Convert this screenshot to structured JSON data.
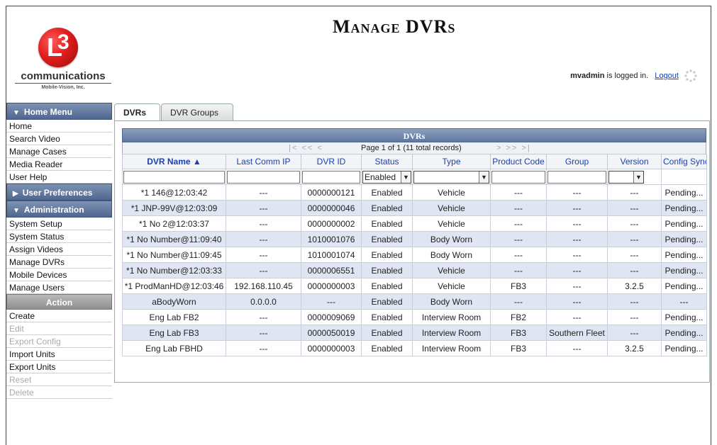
{
  "header": {
    "title": "Manage DVRs",
    "logo_mark": "3",
    "logo_company": "communications",
    "logo_sub": "Mobile-Vision, Inc.",
    "user": "mvadmin",
    "logged_in_text": "is logged in.",
    "logout": "Logout"
  },
  "sidebar": {
    "home_menu": {
      "title": "Home Menu",
      "items": [
        "Home",
        "Search Video",
        "Manage Cases",
        "Media Reader",
        "User Help"
      ]
    },
    "user_prefs": {
      "title": "User Preferences"
    },
    "administration": {
      "title": "Administration",
      "items": [
        "System Setup",
        "System Status",
        "Assign Videos",
        "Manage DVRs",
        "Mobile Devices",
        "Manage Users"
      ]
    },
    "action": {
      "title": "Action",
      "items": [
        {
          "label": "Create",
          "enabled": true
        },
        {
          "label": "Edit",
          "enabled": false
        },
        {
          "label": "Export Config",
          "enabled": false
        },
        {
          "label": "Import Units",
          "enabled": true
        },
        {
          "label": "Export Units",
          "enabled": true
        },
        {
          "label": "Reset",
          "enabled": false
        },
        {
          "label": "Delete",
          "enabled": false
        }
      ]
    }
  },
  "tabs": [
    "DVRs",
    "DVR Groups"
  ],
  "grid": {
    "title": "DVRs",
    "pager_first": "|<",
    "pager_prev_page": "<<",
    "pager_prev": "<",
    "pager_info": "Page 1 of 1 (11 total records)",
    "pager_next": ">",
    "pager_next_page": ">>",
    "pager_last": ">|",
    "columns": [
      "DVR Name ▲",
      "Last Comm IP",
      "DVR ID",
      "Status",
      "Type",
      "Product Code",
      "Group",
      "Version",
      "Config Synch"
    ],
    "status_filter": "Enabled",
    "rows": [
      [
        "*1 146@12:03:42",
        "---",
        "0000000121",
        "Enabled",
        "Vehicle",
        "---",
        "---",
        "---",
        "Pending..."
      ],
      [
        "*1 JNP-99V@12:03:09",
        "---",
        "0000000046",
        "Enabled",
        "Vehicle",
        "---",
        "---",
        "---",
        "Pending..."
      ],
      [
        "*1 No 2@12:03:37",
        "---",
        "0000000002",
        "Enabled",
        "Vehicle",
        "---",
        "---",
        "---",
        "Pending..."
      ],
      [
        "*1 No Number@11:09:40",
        "---",
        "1010001076",
        "Enabled",
        "Body Worn",
        "---",
        "---",
        "---",
        "Pending..."
      ],
      [
        "*1 No Number@11:09:45",
        "---",
        "1010001074",
        "Enabled",
        "Body Worn",
        "---",
        "---",
        "---",
        "Pending..."
      ],
      [
        "*1 No Number@12:03:33",
        "---",
        "0000006551",
        "Enabled",
        "Vehicle",
        "---",
        "---",
        "---",
        "Pending..."
      ],
      [
        "*1 ProdManHD@12:03:46",
        "192.168.110.45",
        "0000000003",
        "Enabled",
        "Vehicle",
        "FB3",
        "---",
        "3.2.5",
        "Pending..."
      ],
      [
        "aBodyWorn",
        "0.0.0.0",
        "---",
        "Enabled",
        "Body Worn",
        "---",
        "---",
        "---",
        "---"
      ],
      [
        "Eng Lab FB2",
        "---",
        "0000009069",
        "Enabled",
        "Interview Room",
        "FB2",
        "---",
        "---",
        "Pending..."
      ],
      [
        "Eng Lab FB3",
        "---",
        "0000050019",
        "Enabled",
        "Interview Room",
        "FB3",
        "Southern Fleet",
        "---",
        "Pending..."
      ],
      [
        "Eng Lab FBHD",
        "---",
        "0000000003",
        "Enabled",
        "Interview Room",
        "FB3",
        "---",
        "3.2.5",
        "Pending..."
      ]
    ]
  },
  "icons": {
    "menu_open": "triangle-down-icon",
    "menu_closed": "triangle-right-icon",
    "sort_asc": "triangle-up-icon",
    "loading": "spinner-icon"
  }
}
